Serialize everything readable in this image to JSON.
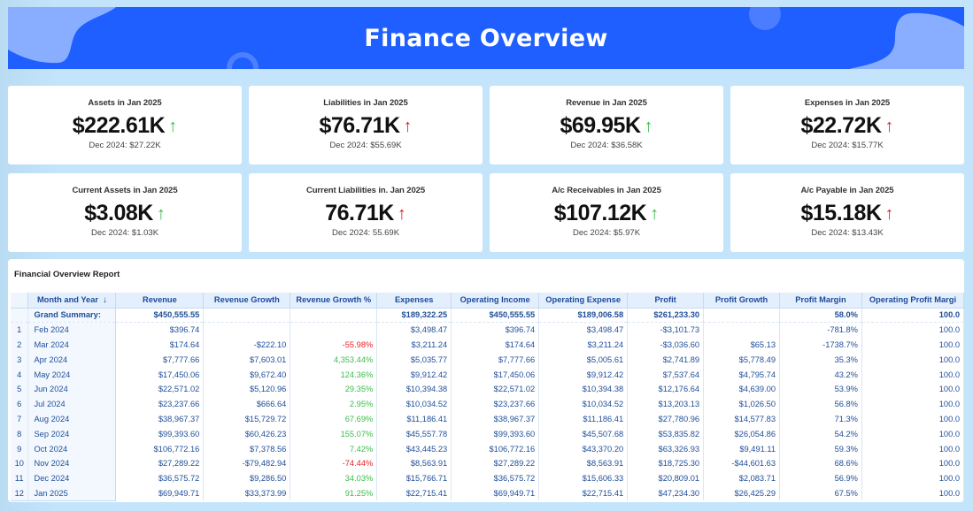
{
  "header": {
    "title": "Finance Overview",
    "bg_color": "#1f5fff"
  },
  "kpis": [
    {
      "label": "Assets in Jan 2025",
      "value": "$222.61K",
      "trend": "up",
      "trend_color": "green",
      "previous": "Dec 2024: $27.22K"
    },
    {
      "label": "Liabilities in Jan 2025",
      "value": "$76.71K",
      "trend": "up",
      "trend_color": "red",
      "previous": "Dec 2024: $55.69K"
    },
    {
      "label": "Revenue in Jan 2025",
      "value": "$69.95K",
      "trend": "up",
      "trend_color": "green",
      "previous": "Dec 2024: $36.58K"
    },
    {
      "label": "Expenses in Jan 2025",
      "value": "$22.72K",
      "trend": "up",
      "trend_color": "red",
      "previous": "Dec 2024: $15.77K"
    },
    {
      "label": "Current Assets in Jan 2025",
      "value": "$3.08K",
      "trend": "up",
      "trend_color": "green",
      "previous": "Dec 2024: $1.03K"
    },
    {
      "label": "Current Liabilities in. Jan 2025",
      "value": "76.71K",
      "trend": "up",
      "trend_color": "red",
      "previous": "Dec 2024: 55.69K"
    },
    {
      "label": "A/c Receivables in Jan 2025",
      "value": "$107.12K",
      "trend": "up",
      "trend_color": "green",
      "previous": "Dec 2024: $5.97K"
    },
    {
      "label": "A/c Payable in Jan 2025",
      "value": "$15.18K",
      "trend": "up",
      "trend_color": "red",
      "previous": "Dec 2024: $13.43K"
    }
  ],
  "trend_icons": {
    "up": "↑"
  },
  "colors": {
    "green": "#3cbc4a",
    "red": "#e8212a",
    "table_text": "#1f4e9a"
  },
  "report": {
    "title": "Financial Overview Report",
    "columns": [
      "Month and Year",
      "Revenue",
      "Revenue Growth",
      "Revenue Growth %",
      "Expenses",
      "Operating Income",
      "Operating Expense",
      "Profit",
      "Profit Growth",
      "Profit Margin",
      "Operating Profit Margi"
    ],
    "sort_icon": "↓",
    "summary": {
      "label": "Grand Summary:",
      "cells": [
        "$450,555.55",
        "",
        "",
        "$189,322.25",
        "$450,555.55",
        "$189,006.58",
        "$261,233.30",
        "",
        "58.0%",
        "100.0"
      ]
    },
    "rows": [
      {
        "idx": "1",
        "month": "Feb 2024",
        "cells": [
          "$396.74",
          "",
          "",
          "$3,498.47",
          "$396.74",
          "$3,498.47",
          "-$3,101.73",
          "",
          "-781.8%",
          "100.0"
        ]
      },
      {
        "idx": "2",
        "month": "Mar 2024",
        "cells": [
          "$174.64",
          "-$222.10",
          "-55.98%",
          "$3,211.24",
          "$174.64",
          "$3,211.24",
          "-$3,036.60",
          "$65.13",
          "-1738.7%",
          "100.0"
        ]
      },
      {
        "idx": "3",
        "month": "Apr 2024",
        "cells": [
          "$7,777.66",
          "$7,603.01",
          "4,353.44%",
          "$5,035.77",
          "$7,777.66",
          "$5,005.61",
          "$2,741.89",
          "$5,778.49",
          "35.3%",
          "100.0"
        ]
      },
      {
        "idx": "4",
        "month": "May 2024",
        "cells": [
          "$17,450.06",
          "$9,672.40",
          "124.36%",
          "$9,912.42",
          "$17,450.06",
          "$9,912.42",
          "$7,537.64",
          "$4,795.74",
          "43.2%",
          "100.0"
        ]
      },
      {
        "idx": "5",
        "month": "Jun 2024",
        "cells": [
          "$22,571.02",
          "$5,120.96",
          "29.35%",
          "$10,394.38",
          "$22,571.02",
          "$10,394.38",
          "$12,176.64",
          "$4,639.00",
          "53.9%",
          "100.0"
        ]
      },
      {
        "idx": "6",
        "month": "Jul 2024",
        "cells": [
          "$23,237.66",
          "$666.64",
          "2.95%",
          "$10,034.52",
          "$23,237.66",
          "$10,034.52",
          "$13,203.13",
          "$1,026.50",
          "56.8%",
          "100.0"
        ]
      },
      {
        "idx": "7",
        "month": "Aug 2024",
        "cells": [
          "$38,967.37",
          "$15,729.72",
          "67.69%",
          "$11,186.41",
          "$38,967.37",
          "$11,186.41",
          "$27,780.96",
          "$14,577.83",
          "71.3%",
          "100.0"
        ]
      },
      {
        "idx": "8",
        "month": "Sep 2024",
        "cells": [
          "$99,393.60",
          "$60,426.23",
          "155.07%",
          "$45,557.78",
          "$99,393.60",
          "$45,507.68",
          "$53,835.82",
          "$26,054.86",
          "54.2%",
          "100.0"
        ]
      },
      {
        "idx": "9",
        "month": "Oct 2024",
        "cells": [
          "$106,772.16",
          "$7,378.56",
          "7.42%",
          "$43,445.23",
          "$106,772.16",
          "$43,370.20",
          "$63,326.93",
          "$9,491.11",
          "59.3%",
          "100.0"
        ]
      },
      {
        "idx": "10",
        "month": "Nov 2024",
        "cells": [
          "$27,289.22",
          "-$79,482.94",
          "-74.44%",
          "$8,563.91",
          "$27,289.22",
          "$8,563.91",
          "$18,725.30",
          "-$44,601.63",
          "68.6%",
          "100.0"
        ]
      },
      {
        "idx": "11",
        "month": "Dec 2024",
        "cells": [
          "$36,575.72",
          "$9,286.50",
          "34.03%",
          "$15,766.71",
          "$36,575.72",
          "$15,606.33",
          "$20,809.01",
          "$2,083.71",
          "56.9%",
          "100.0"
        ]
      },
      {
        "idx": "12",
        "month": "Jan 2025",
        "cells": [
          "$69,949.71",
          "$33,373.99",
          "91.25%",
          "$22,715.41",
          "$69,949.71",
          "$22,715.41",
          "$47,234.30",
          "$26,425.29",
          "67.5%",
          "100.0"
        ]
      }
    ]
  }
}
